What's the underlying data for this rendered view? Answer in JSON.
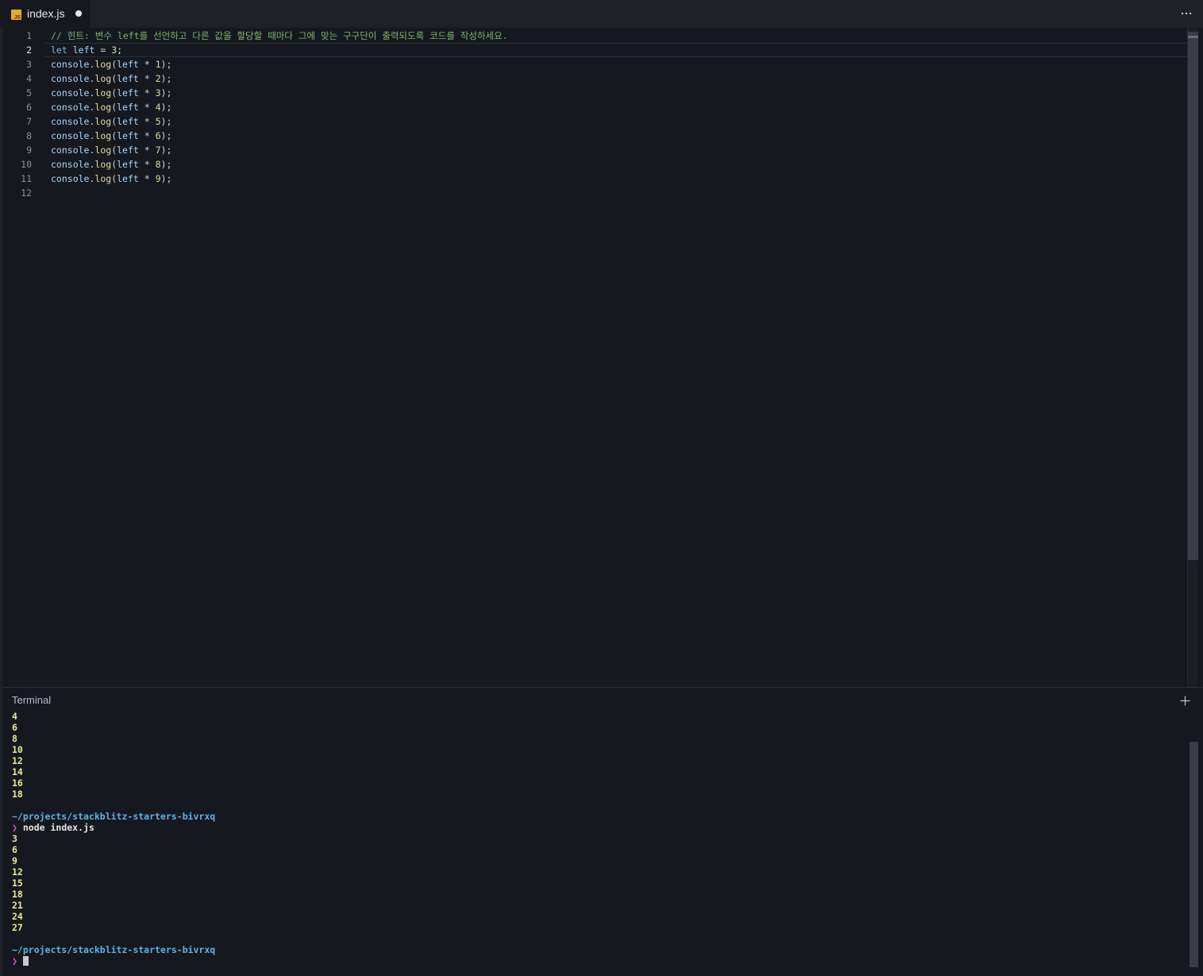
{
  "tab": {
    "filename": "index.js",
    "icon": "javascript-file-icon",
    "modified": true
  },
  "tabbar": {
    "more_icon": "ellipsis-icon"
  },
  "editor": {
    "active_line": 2,
    "lines": [
      {
        "n": "1"
      },
      {
        "n": "2"
      },
      {
        "n": "3"
      },
      {
        "n": "4"
      },
      {
        "n": "5"
      },
      {
        "n": "6"
      },
      {
        "n": "7"
      },
      {
        "n": "8"
      },
      {
        "n": "9"
      },
      {
        "n": "10"
      },
      {
        "n": "11"
      },
      {
        "n": "12"
      }
    ],
    "code": {
      "l1_comment": "// 힌트: 변수 left를 선언하고 다른 값을 할당할 때마다 그에 맞는 구구단이 출력되도록 코드를 작성하세요.",
      "l2_kw": "let",
      "l2_var": "left",
      "l2_eq": " = ",
      "l2_num": "3",
      "l2_end": ";",
      "log_obj": "console",
      "log_dot": ".",
      "log_fn": "log",
      "log_open": "(",
      "log_var": "left",
      "log_op": " * ",
      "log_close": ");",
      "multipliers": [
        "1",
        "2",
        "3",
        "4",
        "5",
        "6",
        "7",
        "8",
        "9"
      ]
    }
  },
  "terminal": {
    "title": "Terminal",
    "add_icon": "plus-icon",
    "previous_output": [
      "4",
      "6",
      "8",
      "10",
      "12",
      "14",
      "16",
      "18"
    ],
    "path": "~/projects/stackblitz-starters-bivrxq",
    "prompt_symbol": "❯",
    "command": "node index.js",
    "current_output": [
      "3",
      "6",
      "9",
      "12",
      "15",
      "18",
      "21",
      "24",
      "27"
    ],
    "path_after": "~/projects/stackblitz-starters-bivrxq"
  },
  "colors": {
    "background": "#16181f",
    "tabbar": "#1f2128",
    "output_yellow": "#e9e79a",
    "path_blue": "#5fb2e3",
    "prompt_pink": "#e04ec4",
    "js_icon": "#e8a833"
  }
}
